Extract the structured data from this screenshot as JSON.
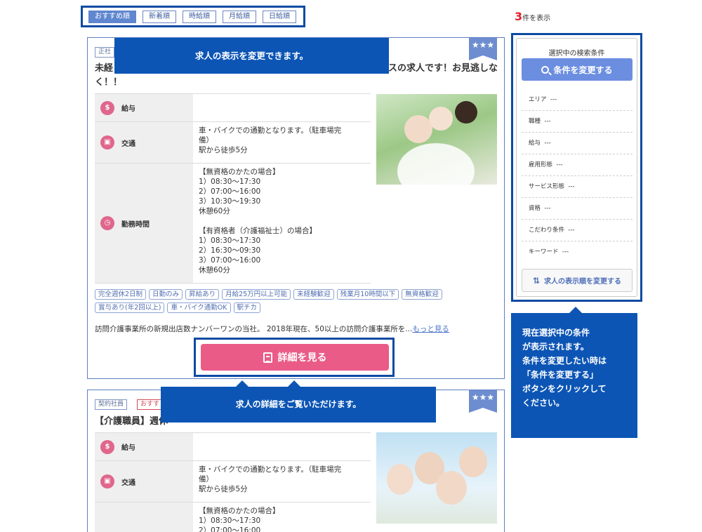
{
  "sort_tabs": [
    "おすすめ順",
    "新着順",
    "時給順",
    "月給順",
    "日給順"
  ],
  "result_count": {
    "number": "3",
    "suffix": "件を表示"
  },
  "callouts": {
    "sort": "求人の表示を変更できます。",
    "detail": "求人の詳細をご覧いただけます。",
    "conditions": "現在選択中の条件\nが表示されます。\n条件を変更したい時は\n「条件を変更する」\nボタンをクリックして\nください。"
  },
  "job1": {
    "ribbon": "★★★",
    "employment_tag": "正社",
    "title_left": "未経",
    "title_right": "スの求人です！お見逃しな",
    "title_line2": "く！！",
    "rows": [
      {
        "label": "給与",
        "icon": "yen-icon",
        "value": ""
      },
      {
        "label": "交通",
        "icon": "train-icon",
        "value": "車・バイクでの通勤となります。（駐車場完\n備）\n駅から徒歩5分"
      },
      {
        "label": "勤務時間",
        "icon": "clock-icon",
        "value": "【無資格のかたの場合】\n1）08:30〜17:30\n2）07:00〜16:00\n3）10:30〜19:30\n休憩60分\n\n【有資格者（介護福祉士）の場合】\n1）08:30〜17:30\n2）16:30〜09:30\n3）07:00〜16:00\n休憩60分"
      }
    ],
    "tags": [
      "完全週休2日制",
      "日勤のみ",
      "昇給あり",
      "月給25万円以上可能",
      "未経験歓迎",
      "残業月10時間以下",
      "無資格歓迎",
      "賞与あり(年2回以上)",
      "車・バイク通勤OK",
      "駅チカ"
    ],
    "description": "訪問介護事業所の新規出店数ナンバーワンの当社。 2018年現在、50以上の訪問介護事業所を...",
    "more_link": "もっと見る",
    "detail_button": "詳細を見る"
  },
  "job2": {
    "ribbon": "★★★",
    "employment_tag": "契約社員",
    "osusume_tag": "おすす",
    "title_left": "【介護職員】週休",
    "rows": [
      {
        "label": "給与",
        "icon": "yen-icon",
        "value": ""
      },
      {
        "label": "交通",
        "icon": "train-icon",
        "value": "車・バイクでの通勤となります。（駐車場完\n備）\n駅から徒歩5分"
      },
      {
        "label": "",
        "icon": "",
        "value": "【無資格のかたの場合】\n1）08:30〜17:30\n2）07:00〜16:00"
      }
    ]
  },
  "sidebar": {
    "title": "選択中の検索条件",
    "change_button": "条件を変更する",
    "conditions": [
      {
        "label": "エリア",
        "value": "---"
      },
      {
        "label": "職種",
        "value": "---"
      },
      {
        "label": "給与",
        "value": "---"
      },
      {
        "label": "雇用形態",
        "value": "---"
      },
      {
        "label": "サービス形態",
        "value": "---"
      },
      {
        "label": "資格",
        "value": "---"
      },
      {
        "label": "こだわり条件",
        "value": "---"
      },
      {
        "label": "キーワード",
        "value": "---"
      }
    ],
    "order_button": "求人の表示順を変更する"
  },
  "colors": {
    "accent_blue": "#0c55b5",
    "pink": "#ea5c87",
    "tab_blue": "#5f86cf"
  }
}
